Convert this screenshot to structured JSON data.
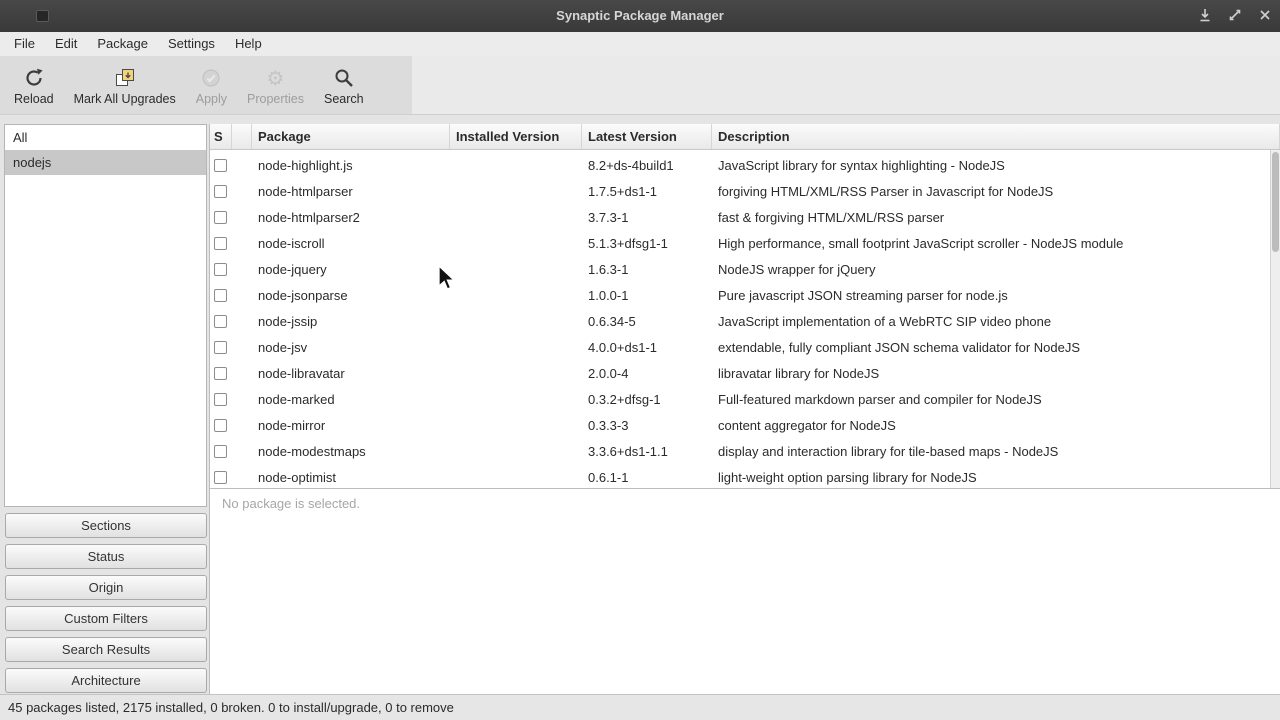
{
  "window": {
    "title": "Synaptic Package Manager",
    "controls": [
      {
        "name": "minimize-button",
        "icon": "minimize-icon"
      },
      {
        "name": "maximize-button",
        "icon": "maximize-icon"
      },
      {
        "name": "close-button",
        "icon": "close-icon"
      }
    ]
  },
  "menubar": {
    "items": [
      "File",
      "Edit",
      "Package",
      "Settings",
      "Help"
    ]
  },
  "toolbar": {
    "buttons": [
      {
        "label": "Reload",
        "icon": "reload-icon",
        "enabled": true
      },
      {
        "label": "Mark All Upgrades",
        "icon": "mark-all-upgrades-icon",
        "enabled": true
      },
      {
        "label": "Apply",
        "icon": "apply-icon",
        "enabled": false
      },
      {
        "label": "Properties",
        "icon": "properties-icon",
        "enabled": false
      },
      {
        "label": "Search",
        "icon": "search-icon",
        "enabled": true
      }
    ]
  },
  "sidebar": {
    "filters": [
      {
        "label": "All",
        "selected": false
      },
      {
        "label": "nodejs",
        "selected": true
      }
    ],
    "buttons": [
      "Sections",
      "Status",
      "Origin",
      "Custom Filters",
      "Search Results",
      "Architecture"
    ]
  },
  "table": {
    "columns": [
      "S",
      "",
      "Package",
      "Installed Version",
      "Latest Version",
      "Description"
    ],
    "rows": [
      {
        "package": "node-highlight.js",
        "installed": "",
        "latest": "8.2+ds-4build1",
        "description": "JavaScript library for syntax highlighting - NodeJS"
      },
      {
        "package": "node-htmlparser",
        "installed": "",
        "latest": "1.7.5+ds1-1",
        "description": "forgiving HTML/XML/RSS Parser in Javascript for NodeJS"
      },
      {
        "package": "node-htmlparser2",
        "installed": "",
        "latest": "3.7.3-1",
        "description": "fast & forgiving HTML/XML/RSS parser"
      },
      {
        "package": "node-iscroll",
        "installed": "",
        "latest": "5.1.3+dfsg1-1",
        "description": "High performance, small footprint JavaScript scroller - NodeJS module"
      },
      {
        "package": "node-jquery",
        "installed": "",
        "latest": "1.6.3-1",
        "description": "NodeJS wrapper for jQuery"
      },
      {
        "package": "node-jsonparse",
        "installed": "",
        "latest": "1.0.0-1",
        "description": "Pure javascript JSON streaming parser for node.js"
      },
      {
        "package": "node-jssip",
        "installed": "",
        "latest": "0.6.34-5",
        "description": "JavaScript implementation of a WebRTC SIP video phone"
      },
      {
        "package": "node-jsv",
        "installed": "",
        "latest": "4.0.0+ds1-1",
        "description": "extendable, fully compliant JSON schema validator for NodeJS"
      },
      {
        "package": "node-libravatar",
        "installed": "",
        "latest": "2.0.0-4",
        "description": "libravatar library for NodeJS"
      },
      {
        "package": "node-marked",
        "installed": "",
        "latest": "0.3.2+dfsg-1",
        "description": "Full-featured markdown parser and compiler for NodeJS"
      },
      {
        "package": "node-mirror",
        "installed": "",
        "latest": "0.3.3-3",
        "description": "content aggregator for NodeJS"
      },
      {
        "package": "node-modestmaps",
        "installed": "",
        "latest": "3.3.6+ds1-1.1",
        "description": "display and interaction library for tile-based maps - NodeJS"
      },
      {
        "package": "node-optimist",
        "installed": "",
        "latest": "0.6.1-1",
        "description": "light-weight option parsing library for NodeJS"
      }
    ]
  },
  "details": {
    "placeholder": "No package is selected."
  },
  "statusbar": {
    "text": "45 packages listed, 2175 installed, 0 broken. 0 to install/upgrade, 0 to remove"
  },
  "colors": {
    "titlebar": "#3d3d3d",
    "selection": "#c8c8c8",
    "upgrade_icon_accent": "#f3d37a"
  }
}
